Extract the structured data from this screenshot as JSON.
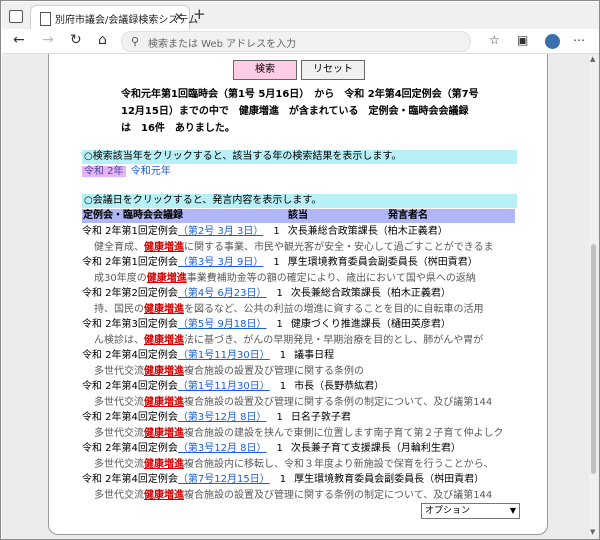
{
  "browser": {
    "tab_title": "別府市議会/会議録検索システム",
    "address_placeholder": "検索または Web アドレスを入力",
    "icons": {
      "close": "close-icon",
      "new_tab": "plus-icon",
      "back": "back-arrow-icon",
      "refresh": "refresh-icon",
      "search": "search-icon",
      "favorites": "star-icon",
      "collections": "collections-icon",
      "profile": "avatar"
    }
  },
  "page": {
    "search_button": "検索",
    "reset_button": "リセット",
    "summary": "令和元年第1回臨時会（第1号 5月16日）　から　令和 2年第4回定例会（第7号12月15日）までの中で　健康増進　が含まれている　定例会・臨時会会議録　は　16件　ありました。",
    "year_instruction": "○検索該当年をクリックすると、該当する年の検索結果を表示します。",
    "years": [
      "令和 2年",
      "令和元年"
    ],
    "date_instruction": "○会議日をクリックすると、発言内容を表示します。",
    "columns": [
      "定例会・臨時会会議録",
      "該当",
      "発言者名"
    ],
    "keyword": "健康増進",
    "options_label": "オプション",
    "accent_color": "#b7f0f7"
  },
  "rows": [
    {
      "session": "令和 2年第1回定例会",
      "date": "（第2号 3月 3日）",
      "count": "1",
      "speaker": "次長兼総合政策課長（柏木正義君）",
      "before": "健全育成、",
      "after": "に関する事業、市民や観光客が安全・安心して過ごすことができるま"
    },
    {
      "session": "令和 2年第1回定例会",
      "date": "（第3号 3月 9日）",
      "count": "1",
      "speaker": "厚生環境教育委員会副委員長（桝田貢君）",
      "before": "成30年度の",
      "after": "事業費補助金等の額の確定により、歳出において国や県への返納"
    },
    {
      "session": "令和 2年第2回定例会",
      "date": "（第4号 6月23日）",
      "count": "1",
      "speaker": "次長兼総合政策課長（柏木正義君）",
      "before": "持、国民の",
      "after": "を図るなど、公共の利益の増進に資することを目的に自転車の活用"
    },
    {
      "session": "令和 2年第3回定例会",
      "date": "（第5号 9月18日）",
      "count": "1",
      "speaker": "健康づくり推進課長（樋田英彦君）",
      "before": "ん検診は、",
      "after": "法に基づき、がんの早期発見・早期治療を目的とし、肺がんや胃が"
    },
    {
      "session": "令和 2年第4回定例会",
      "date": "（第1号11月30日）",
      "count": "1",
      "speaker": "議事日程",
      "before": "多世代交流",
      "after": "複合施設の設置及び管理に関する条例の"
    },
    {
      "session": "令和 2年第4回定例会",
      "date": "（第1号11月30日）",
      "count": "1",
      "speaker": "市長（長野恭紘君）",
      "before": "多世代交流",
      "after": "複合施設の設置及び管理に関する条例の制定について、及び議第144"
    },
    {
      "session": "令和 2年第4回定例会",
      "date": "（第3号12月 8日）",
      "count": "1",
      "speaker": "日名子敦子君",
      "before": "多世代交流",
      "after": "複合施設の建設を挟んで東側に位置します南子育て第２子育て仲よしク"
    },
    {
      "session": "令和 2年第4回定例会",
      "date": "（第3号12月 8日）",
      "count": "1",
      "speaker": "次長兼子育て支援課長（月輪利生君）",
      "before": "多世代交流",
      "after": "複合施設内に移転し、令和３年度より新施設で保育を行うことから、"
    },
    {
      "session": "令和 2年第4回定例会",
      "date": "（第7号12月15日）",
      "count": "1",
      "speaker": "厚生環境教育委員会副委員長（桝田貢君）",
      "before": "多世代交流",
      "after": "複合施設の設置及び管理に関する条例の制定について、及び議第144"
    }
  ]
}
